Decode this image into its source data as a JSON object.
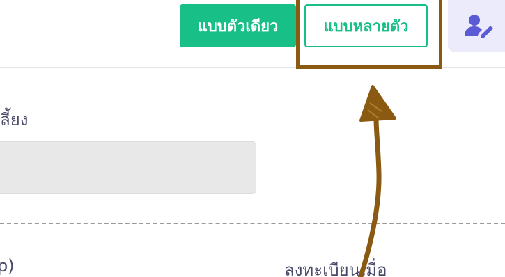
{
  "header": {
    "single_mode_label": "แบบตัวเดียว",
    "multi_mode_label": "แบบหลายตัว",
    "user_edit_icon": "user-edit-icon"
  },
  "form": {
    "field_label": "ลี้ยง",
    "field_value": ""
  },
  "table_header": {
    "left_column": "p)",
    "right_column": "ลงทะเบียนเมื่อ"
  },
  "colors": {
    "primary_green": "#18bf86",
    "annotation_brown": "#8a5a12",
    "user_button_bg": "#ecebfb",
    "user_icon": "#5b5bd6"
  }
}
